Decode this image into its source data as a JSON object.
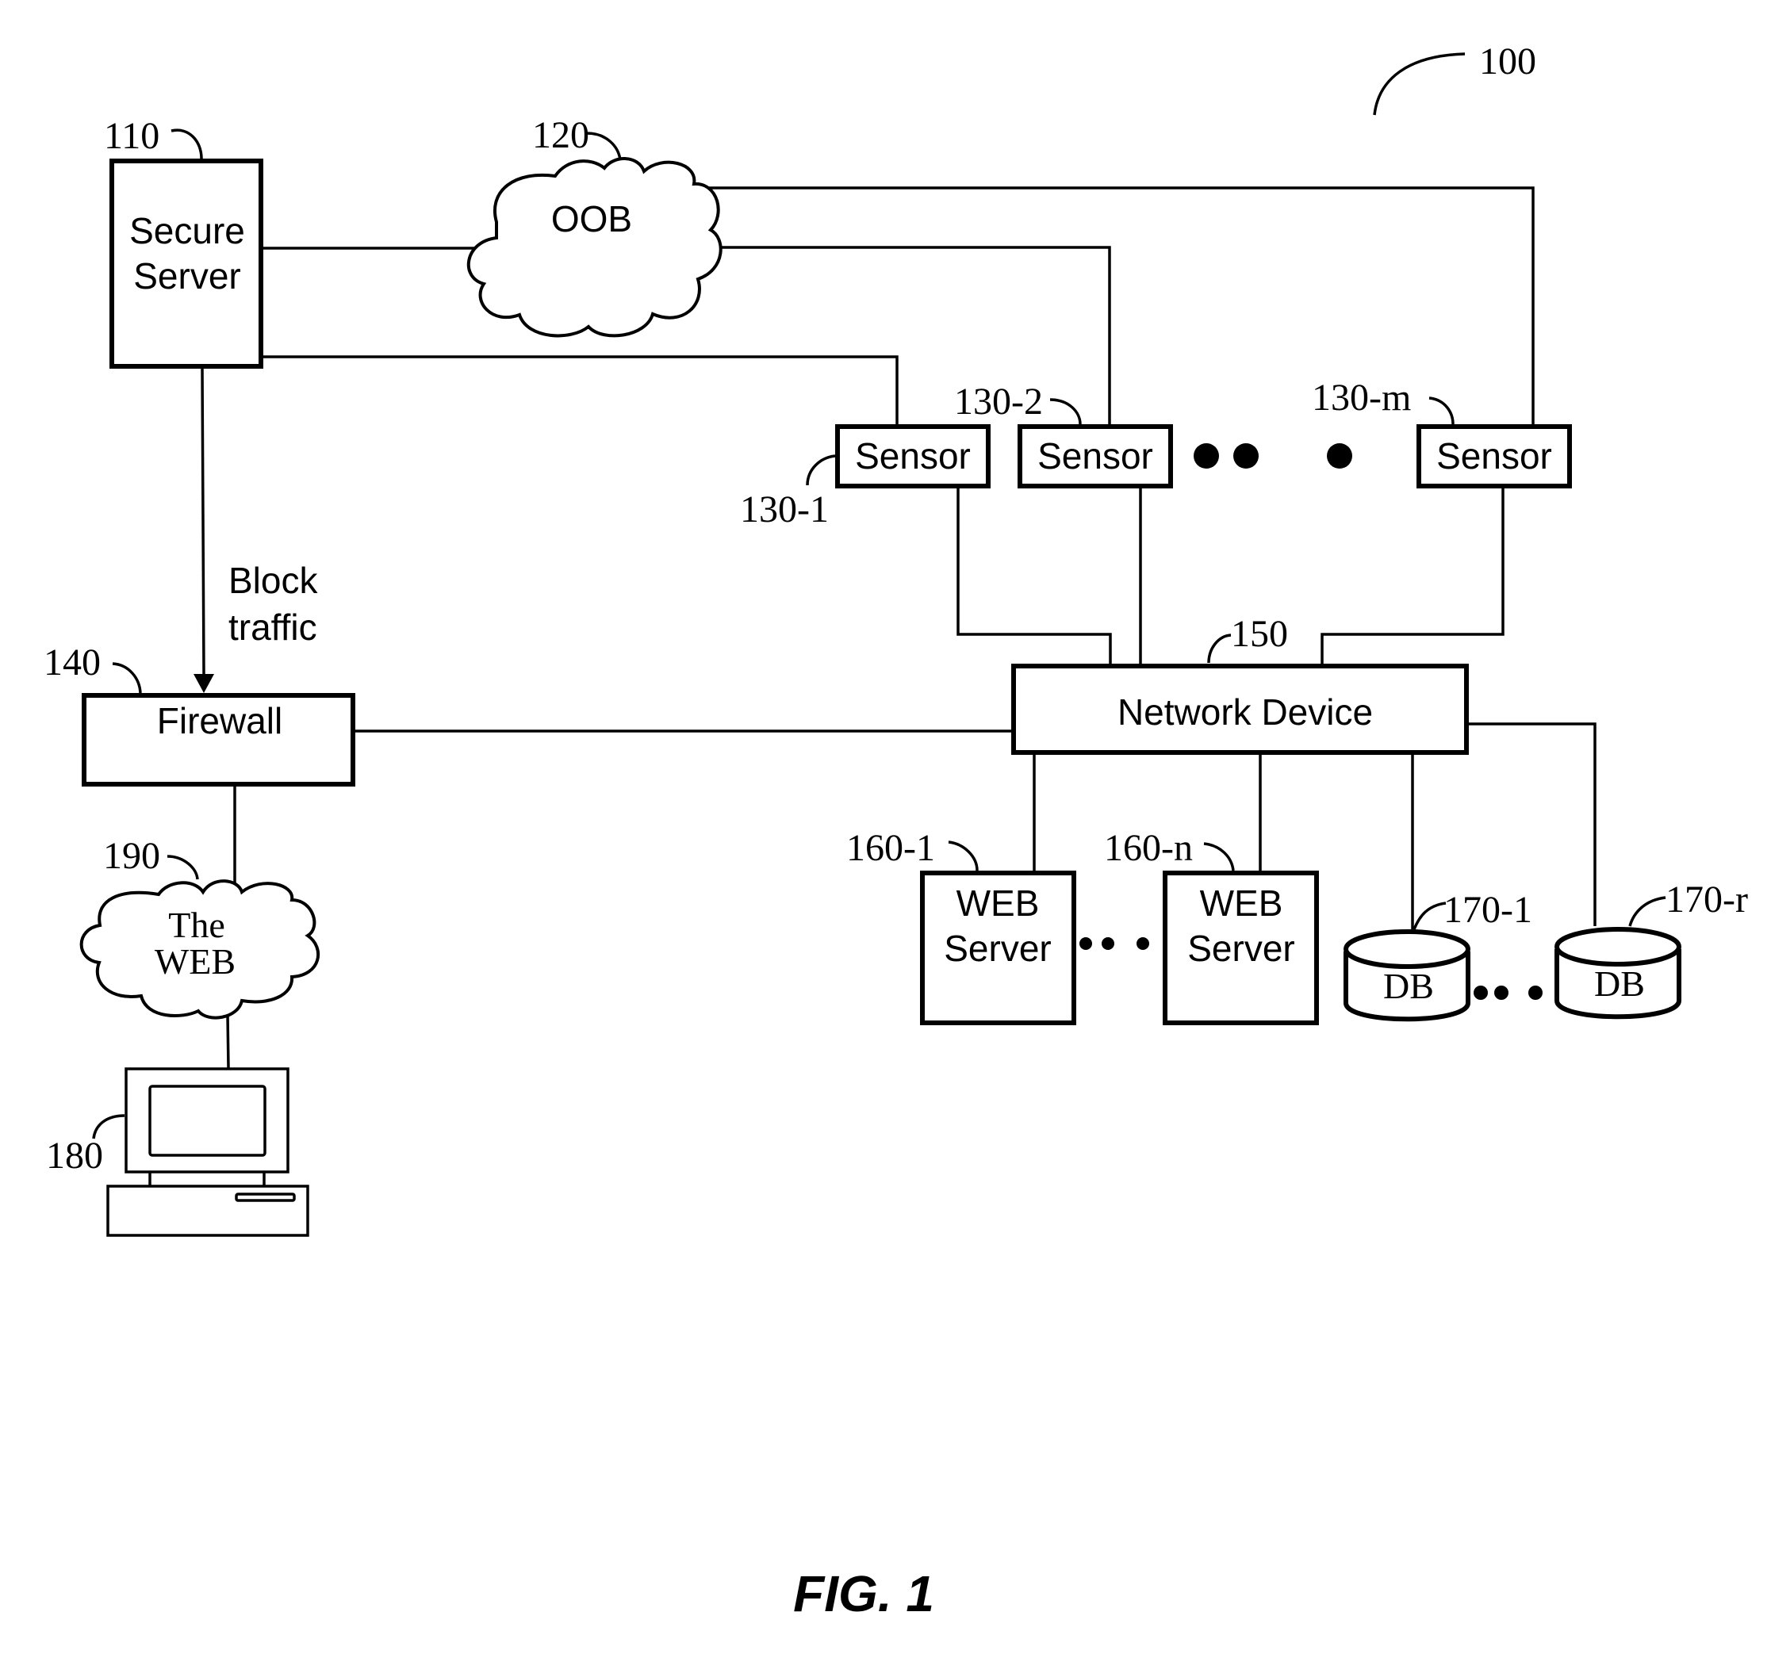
{
  "figure": {
    "caption": "FIG. 1",
    "system_ref": "100"
  },
  "nodes": {
    "secure_server": {
      "ref": "110",
      "lines": [
        "Secure",
        "Server"
      ]
    },
    "oob": {
      "ref": "120",
      "label": "OOB"
    },
    "sensors": [
      {
        "ref": "130-1",
        "label": "Sensor"
      },
      {
        "ref": "130-2",
        "label": "Sensor"
      },
      {
        "ref": "130-m",
        "label": "Sensor"
      }
    ],
    "firewall": {
      "ref": "140",
      "label": "Firewall"
    },
    "block_traffic": {
      "lines": [
        "Block",
        "traffic"
      ]
    },
    "network_device": {
      "ref": "150",
      "label": "Network Device"
    },
    "web_servers": [
      {
        "ref": "160-1",
        "lines": [
          "WEB",
          "Server"
        ]
      },
      {
        "ref": "160-n",
        "lines": [
          "WEB",
          "Server"
        ]
      }
    ],
    "databases": [
      {
        "ref": "170-1",
        "label": "DB"
      },
      {
        "ref": "170-r",
        "label": "DB"
      }
    ],
    "client_computer": {
      "ref": "180"
    },
    "the_web": {
      "ref": "190",
      "lines": [
        "The",
        "WEB"
      ]
    }
  },
  "edges": [
    {
      "from": "Secure Server",
      "to": "OOB"
    },
    {
      "from": "OOB",
      "to": "Sensor 130-2"
    },
    {
      "from": "OOB",
      "to": "Sensor 130-m"
    },
    {
      "from": "Secure Server",
      "to": "Sensor 130-1"
    },
    {
      "from": "Secure Server",
      "to": "Firewall",
      "label": "Block traffic",
      "directed": true
    },
    {
      "from": "Sensor 130-1",
      "to": "Network Device"
    },
    {
      "from": "Sensor 130-2",
      "to": "Network Device"
    },
    {
      "from": "Sensor 130-m",
      "to": "Network Device"
    },
    {
      "from": "Firewall",
      "to": "Network Device"
    },
    {
      "from": "Firewall",
      "to": "The WEB"
    },
    {
      "from": "The WEB",
      "to": "Computer 180"
    },
    {
      "from": "Network Device",
      "to": "WEB Server 160-1"
    },
    {
      "from": "Network Device",
      "to": "WEB Server 160-n"
    },
    {
      "from": "Network Device",
      "to": "DB 170-1"
    },
    {
      "from": "Network Device",
      "to": "DB 170-r"
    }
  ]
}
